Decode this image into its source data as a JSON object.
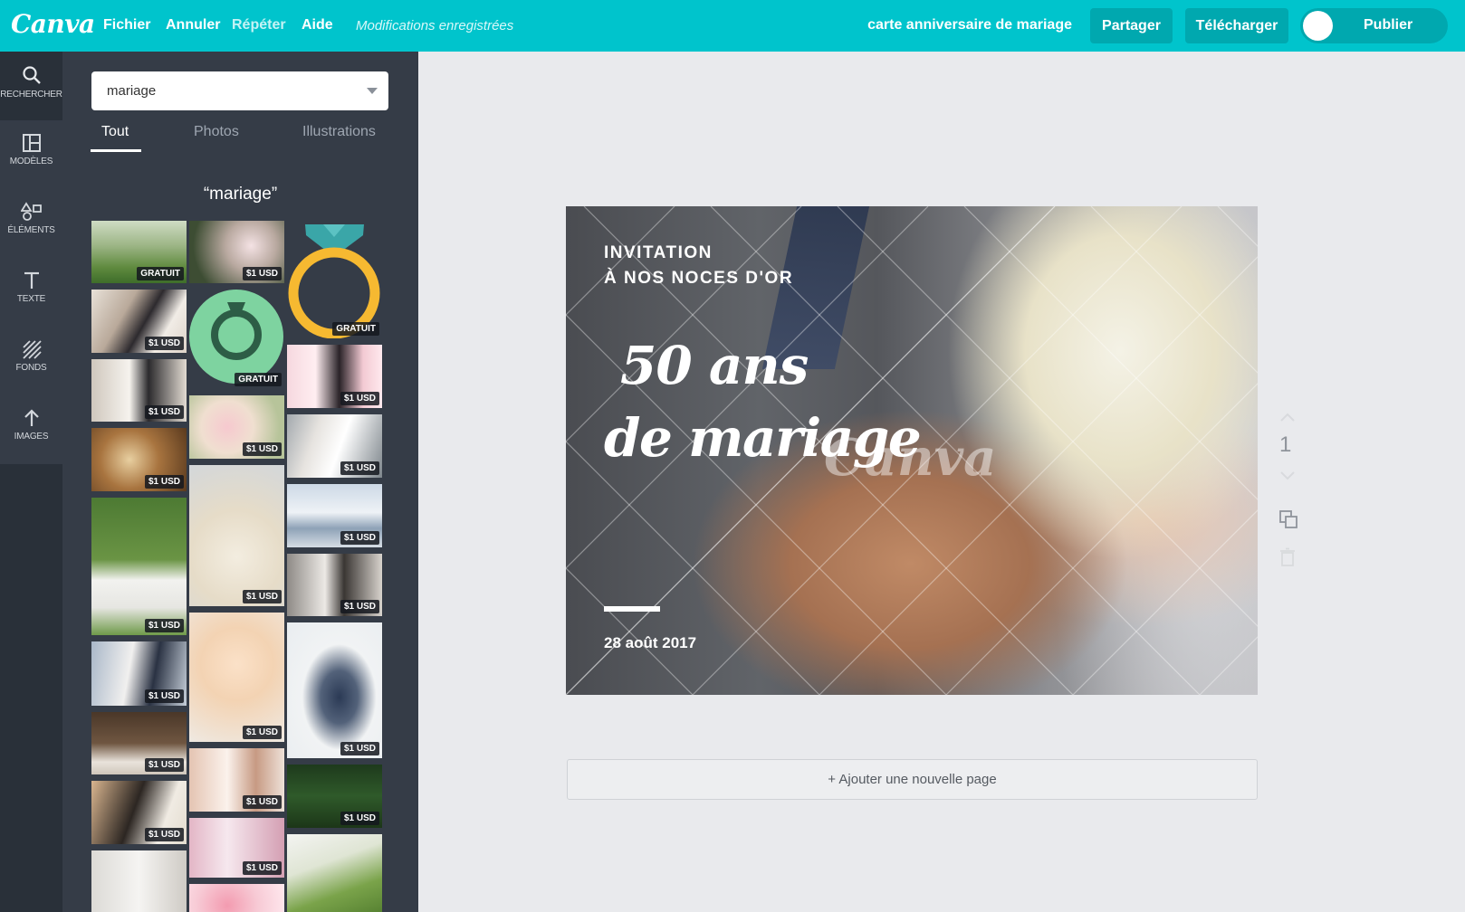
{
  "app": {
    "logo": "Canva",
    "menu": [
      "Fichier",
      "Annuler",
      "Répéter",
      "Aide"
    ],
    "save_status": "Modifications enregistrées",
    "doc_title": "carte anniversaire de mariage",
    "share_label": "Partager",
    "download_label": "Télécharger",
    "publish_label": "Publier",
    "accent_color": "#00c4cc"
  },
  "rail": [
    {
      "label": "RECHERCHER",
      "icon": "search-icon"
    },
    {
      "label": "MODÈLES",
      "icon": "layout-icon"
    },
    {
      "label": "ÉLÉMENTS",
      "icon": "shapes-icon"
    },
    {
      "label": "TEXTE",
      "icon": "text-icon"
    },
    {
      "label": "FONDS",
      "icon": "background-icon"
    },
    {
      "label": "IMAGES",
      "icon": "upload-icon"
    }
  ],
  "search": {
    "value": "mariage",
    "tabs": [
      "Tout",
      "Photos",
      "Illustrations"
    ],
    "active_tab": "Tout",
    "results_title": "“mariage”",
    "badges": {
      "free": "GRATUIT",
      "paid": "$1 USD"
    }
  },
  "design": {
    "invite_line1": "INVITATION",
    "invite_line2": "À NOS NOCES D'OR",
    "headline1": "50 ans",
    "headline2": "de mariage",
    "watermark": "Canva",
    "date": "28 août 2017"
  },
  "page_number": "1",
  "add_page_label": "+ Ajouter une nouvelle page"
}
